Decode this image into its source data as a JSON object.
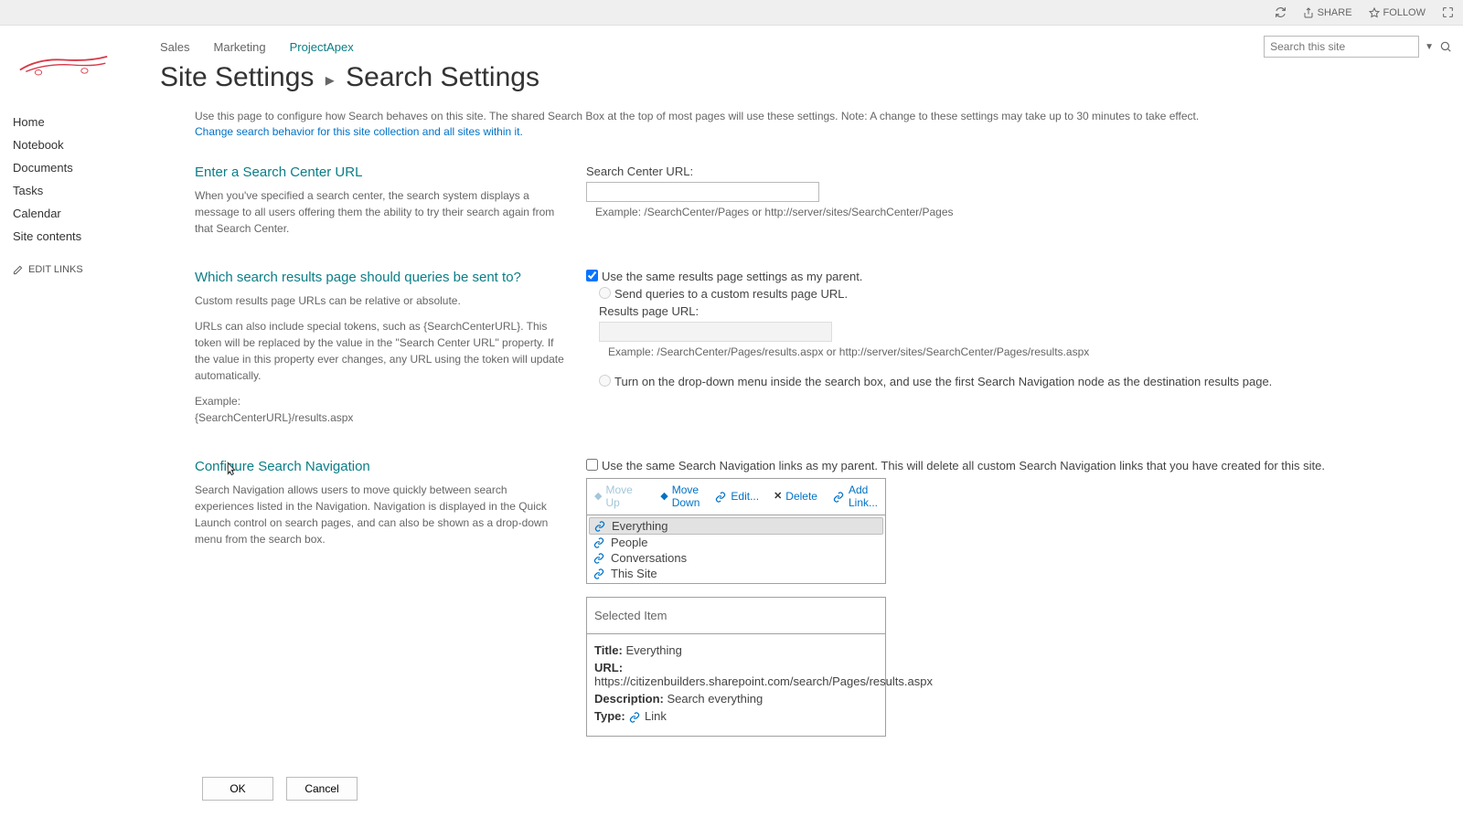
{
  "topbar": {
    "share": "SHARE",
    "follow": "FOLLOW"
  },
  "topnav": {
    "items": [
      {
        "label": "Sales",
        "active": false
      },
      {
        "label": "Marketing",
        "active": false
      },
      {
        "label": "ProjectApex",
        "active": true
      }
    ],
    "search_placeholder": "Search this site"
  },
  "breadcrumb": {
    "parent": "Site Settings",
    "current": "Search Settings"
  },
  "leftnav": {
    "items": [
      "Home",
      "Notebook",
      "Documents",
      "Tasks",
      "Calendar",
      "Site contents"
    ],
    "edit": "EDIT LINKS"
  },
  "intro": {
    "text": "Use this page to configure how Search behaves on this site. The shared Search Box at the top of most pages will use these settings. Note: A change to these settings may take up to 30 minutes to take effect.",
    "link": "Change search behavior for this site collection and all sites within it."
  },
  "section1": {
    "title": "Enter a Search Center URL",
    "desc": "When you've specified a search center, the search system displays a message to all users offering them the ability to try their search again from that Search Center.",
    "label": "Search Center URL:",
    "example": "Example: /SearchCenter/Pages or http://server/sites/SearchCenter/Pages"
  },
  "section2": {
    "title": "Which search results page should queries be sent to?",
    "desc1": "Custom results page URLs can be relative or absolute.",
    "desc2": "URLs can also include special tokens, such as {SearchCenterURL}. This token will be replaced by the value in the \"Search Center URL\" property. If the value in this property ever changes, any URL using the token will update automatically.",
    "desc3a": "Example:",
    "desc3b": "{SearchCenterURL}/results.aspx",
    "opt_parent": "Use the same results page settings as my parent.",
    "opt_custom": "Send queries to a custom results page URL.",
    "results_label": "Results page URL:",
    "results_example": "Example: /SearchCenter/Pages/results.aspx or http://server/sites/SearchCenter/Pages/results.aspx",
    "opt_dropdown": "Turn on the drop-down menu inside the search box, and use the first Search Navigation node as the destination results page."
  },
  "section3": {
    "title": "Configure Search Navigation",
    "desc": "Search Navigation allows users to move quickly between search experiences listed in the Navigation. Navigation is displayed in the Quick Launch control on search pages, and can also be shown as a drop-down menu from the search box.",
    "check_parent": "Use the same Search Navigation links as my parent. This will delete all custom Search Navigation links that you have created for this site.",
    "toolbar": {
      "move_up": "Move Up",
      "move_down_l1": "Move",
      "move_down_l2": "Down",
      "edit": "Edit...",
      "delete": "Delete",
      "add_l1": "Add",
      "add_l2": "Link..."
    },
    "nav_items": [
      "Everything",
      "People",
      "Conversations",
      "This Site"
    ],
    "selected_header": "Selected Item",
    "selected": {
      "title_k": "Title:",
      "title_v": "Everything",
      "url_k": "URL:",
      "url_v": "https://citizenbuilders.sharepoint.com/search/Pages/results.aspx",
      "desc_k": "Description:",
      "desc_v": "Search everything",
      "type_k": "Type:",
      "type_v": "Link"
    }
  },
  "buttons": {
    "ok": "OK",
    "cancel": "Cancel"
  }
}
